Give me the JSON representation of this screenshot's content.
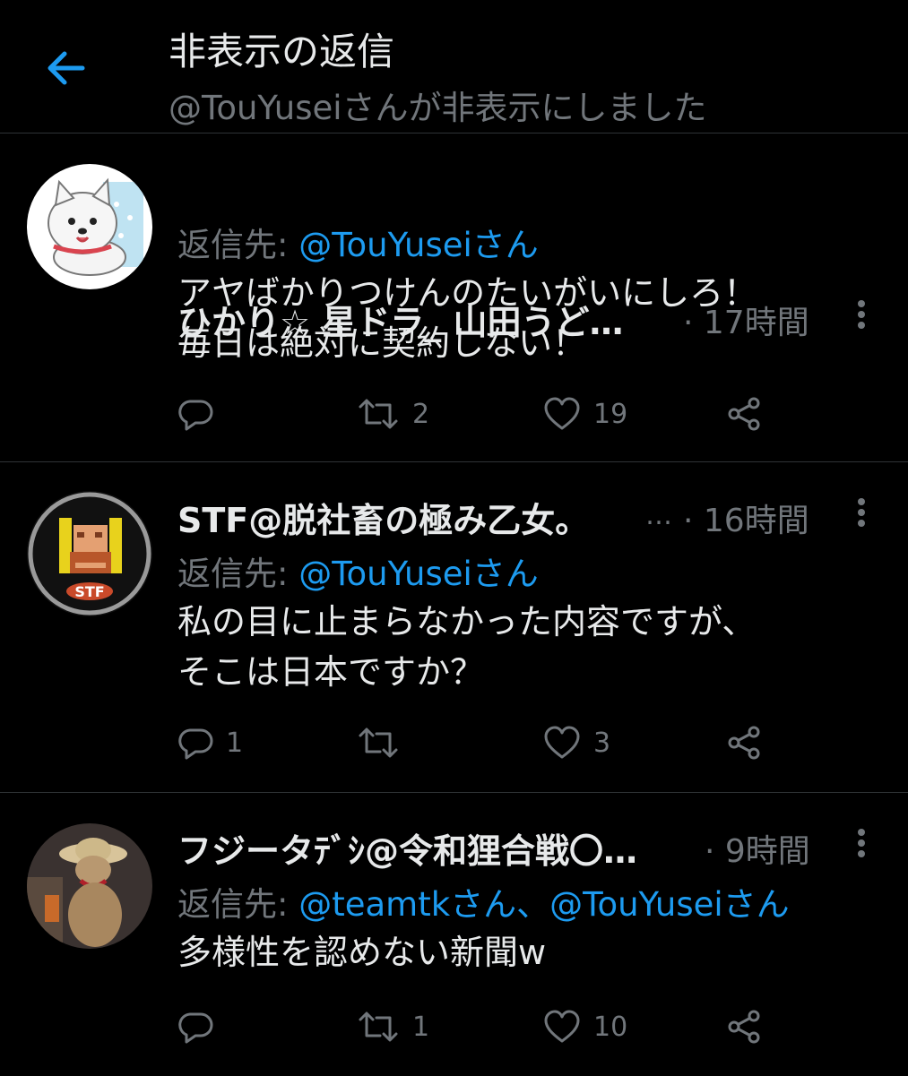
{
  "header": {
    "title": "非表示の返信",
    "subtitle": "@TouYuseiさんが非表示にしました"
  },
  "tweets": [
    {
      "name": "ひかり☆ 星ドラ_ 山田うど…",
      "name_more": "",
      "time": "· 17時間",
      "reply_label": "返信先: ",
      "reply_mentions": "@TouYuseiさん",
      "text": [
        "アヤばかりつけんのたいがいにしろ！",
        "毎日は絶対に契約しない！"
      ],
      "reply_count": "",
      "retweet_count": "2",
      "like_count": "19"
    },
    {
      "name": "STF@脱社畜の極み乙女。",
      "name_more": "…",
      "time": "· 16時間",
      "reply_label": "返信先: ",
      "reply_mentions": "@TouYuseiさん",
      "text": [
        "私の目に止まらなかった内容ですが、",
        "そこは日本ですか？"
      ],
      "reply_count": "1",
      "retweet_count": "",
      "like_count": "3"
    },
    {
      "name": "フジータﾃﾞｼ@令和狸合戦〇…",
      "name_more": "",
      "time": "· 9時間",
      "reply_label": "返信先: ",
      "reply_mentions": "@teamtkさん、@TouYuseiさん",
      "text": [
        "多様性を認めない新聞w"
      ],
      "reply_count": "",
      "retweet_count": "1",
      "like_count": "10"
    }
  ],
  "avatar_labels": {
    "stf": "STF"
  },
  "colors": {
    "accent": "#1d9bf0",
    "muted": "#71767b",
    "background": "#000000"
  }
}
